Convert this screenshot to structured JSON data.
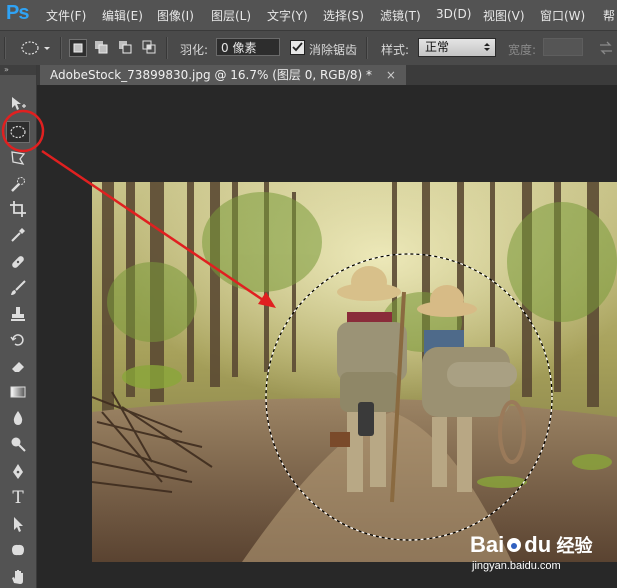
{
  "app": {
    "logo": "Ps"
  },
  "menu": [
    "文件(F)",
    "编辑(E)",
    "图像(I)",
    "图层(L)",
    "文字(Y)",
    "选择(S)",
    "滤镜(T)",
    "3D(D)",
    "视图(V)",
    "窗口(W)",
    "帮"
  ],
  "options": {
    "feather_label": "羽化:",
    "feather_value": "0 像素",
    "antialias_label": "消除锯齿",
    "antialias_checked": true,
    "style_label": "样式:",
    "style_value": "正常",
    "width_label": "宽度:"
  },
  "document": {
    "tab_title": "AdobeStock_73899830.jpg @ 16.7% (图层 0, RGB/8) *",
    "close_glyph": "×"
  },
  "panel": {
    "collapse_glyph": "»"
  },
  "tools": {
    "active": "elliptical-marquee-tool",
    "text_tool_glyph": "T"
  },
  "annotation": {
    "highlight_color": "#e02020"
  },
  "watermark": {
    "logo": "Bai",
    "logo_paw": "du",
    "brand": "经验",
    "url": "jingyan.baidu.com"
  }
}
